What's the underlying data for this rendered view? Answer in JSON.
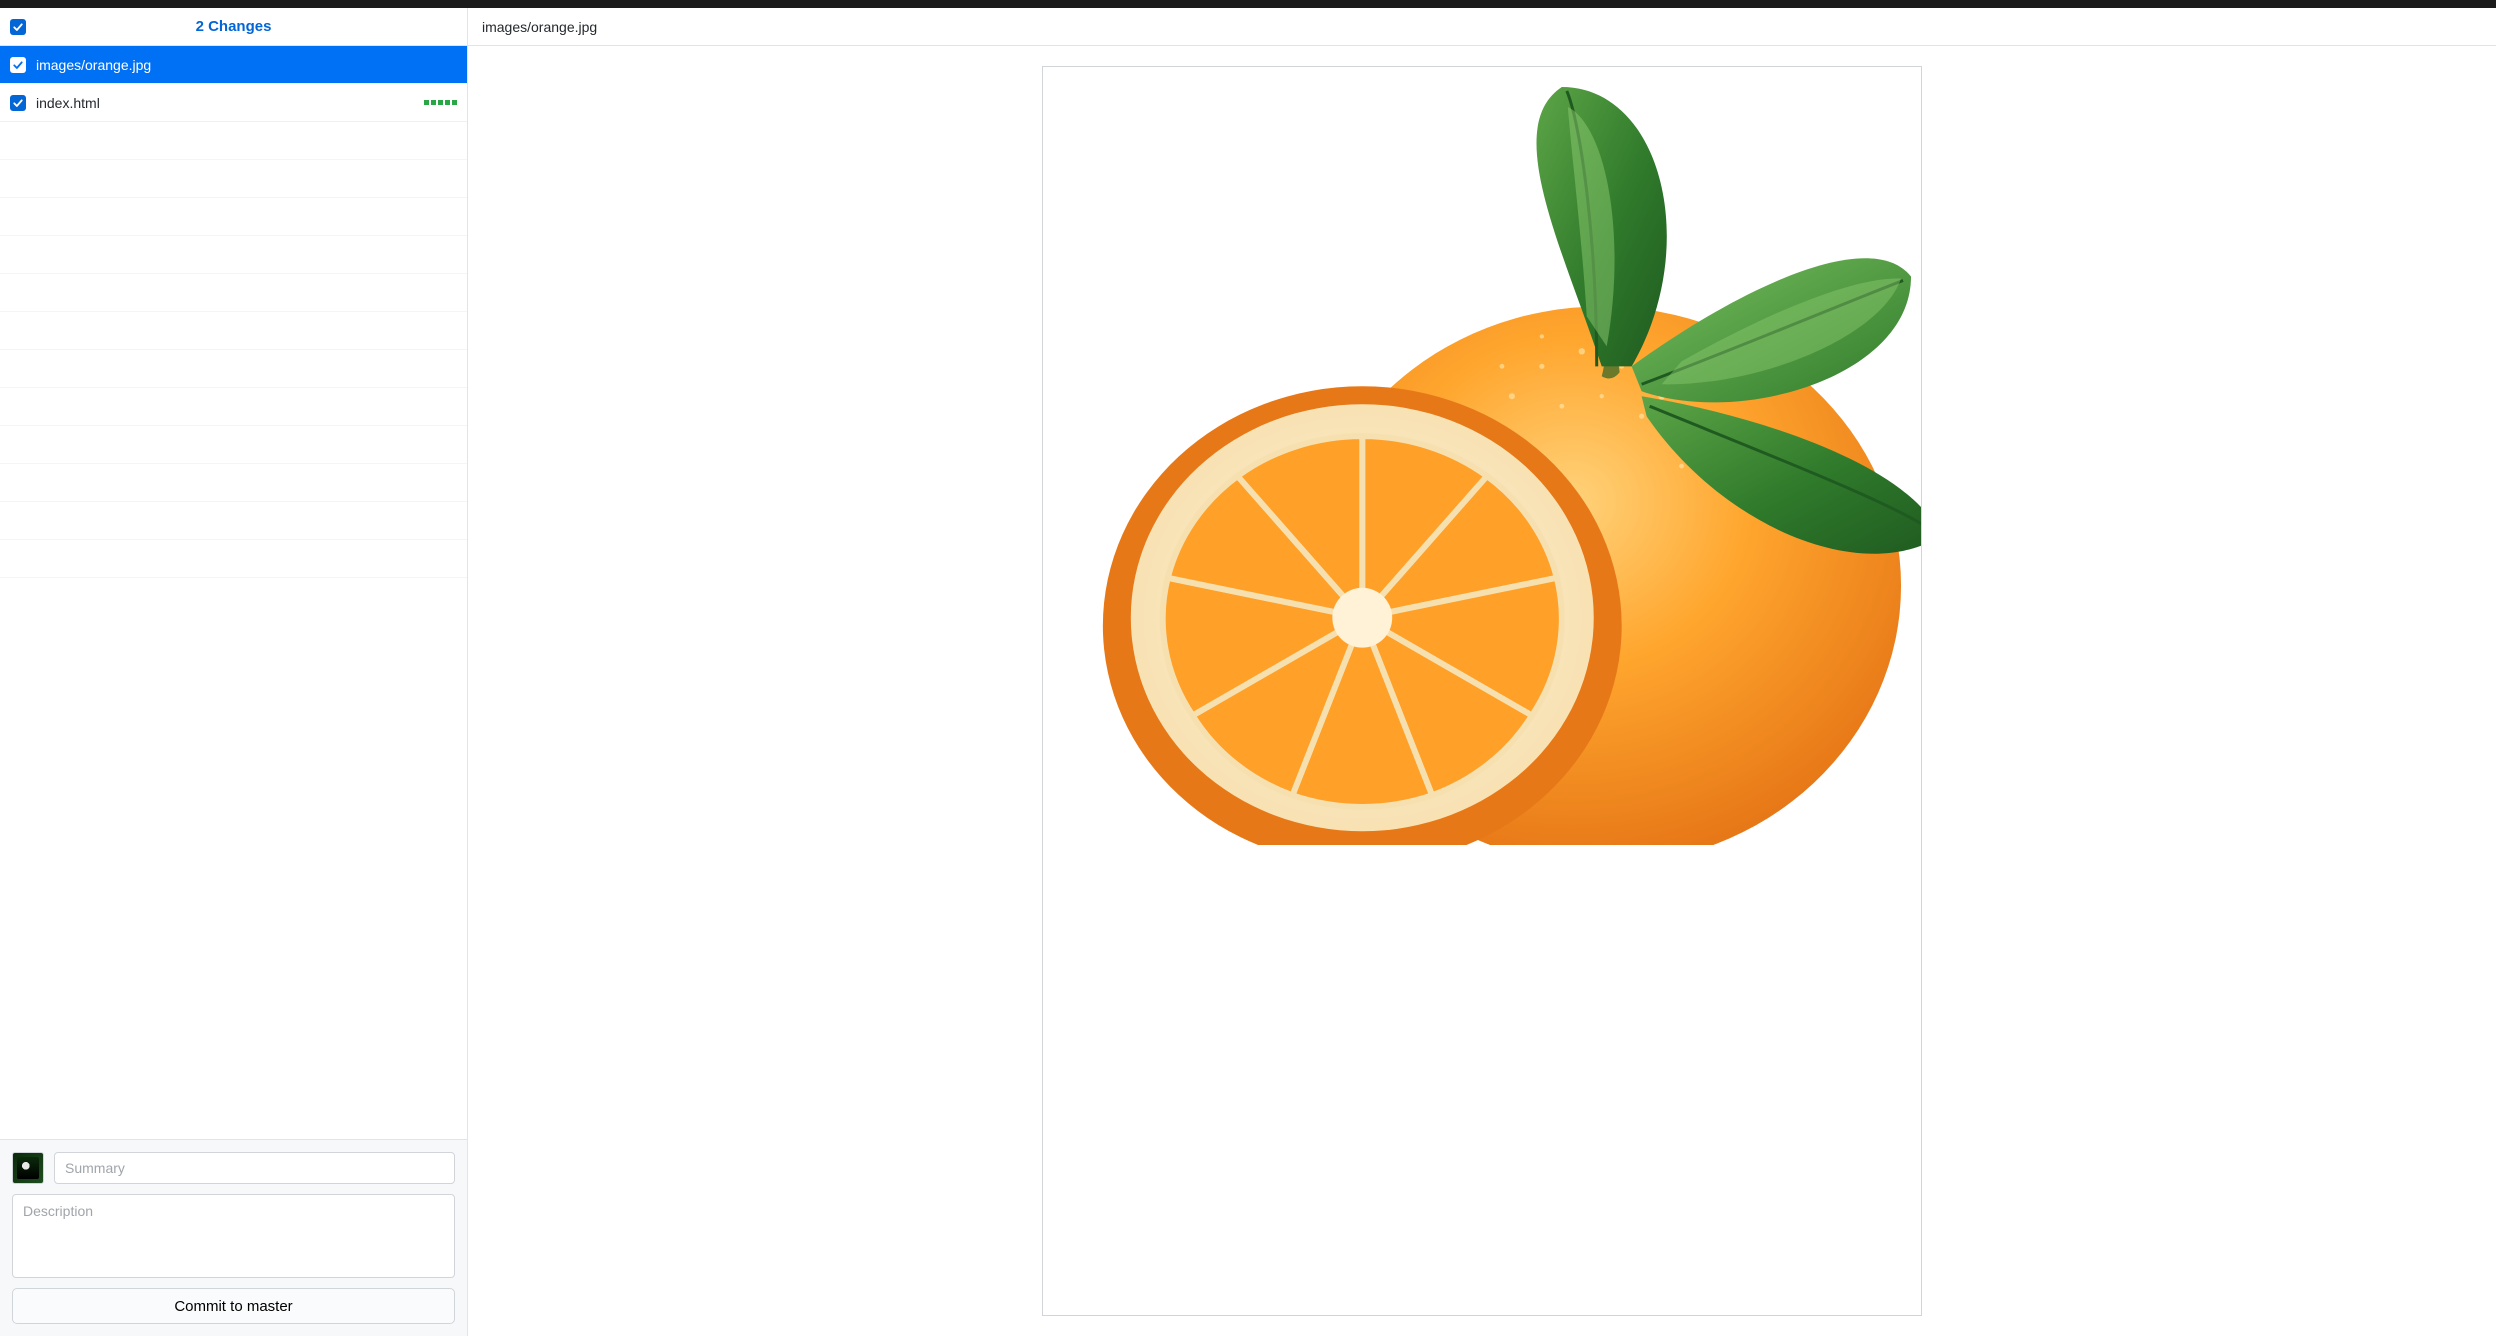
{
  "sidebar": {
    "changes_title": "2 Changes",
    "files": [
      {
        "name": "images/orange.jpg",
        "selected": true,
        "diff_added_squares": 0
      },
      {
        "name": "index.html",
        "selected": false,
        "diff_added_squares": 5
      }
    ]
  },
  "commit": {
    "summary_placeholder": "Summary",
    "description_placeholder": "Description",
    "button_label": "Commit to master"
  },
  "content": {
    "header_path": "images/orange.jpg"
  }
}
